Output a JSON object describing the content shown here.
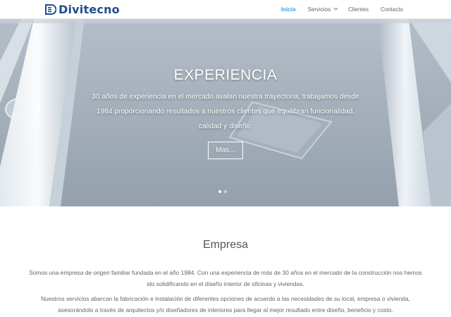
{
  "header": {
    "logo_text": "Divitecno",
    "brand_color": "#1f4e8c",
    "nav": [
      {
        "label": "Inicio",
        "active": true
      },
      {
        "label": "Servicios",
        "has_dropdown": true
      },
      {
        "label": "Clientes"
      },
      {
        "label": "Contacto"
      }
    ],
    "accent": "#2ea3f2"
  },
  "hero": {
    "title": "EXPERIENCIA",
    "text": "30 años de experiencia en el mercado avalan nuestra trayectoria, trabajamos desde 1984 proporcionando resultados a nuestros clientes que equilibran funcionalidad, calidad y diseño.",
    "button_label": "Mas...",
    "slides": 2,
    "active_slide": 1
  },
  "empresa": {
    "title": "Empresa",
    "paragraph_1": "Somos una empresa de origen familiar fundada en el año 1984. Con una experiencia de más de 30 años en el mercado de la construcción nos hemos ido solidificando en el diseño interior de oficinas y viviendas.",
    "paragraph_2": "Nuestros servicios abarcan la fabricación e instalación de diferentes opciones de acuerdo a las necesidades de su local, empresa o vivienda, asesorándolo a través de arquitectos y/o diseñadores de interiores para llegar al mejor resultado entre diseño, beneficio y costo."
  }
}
